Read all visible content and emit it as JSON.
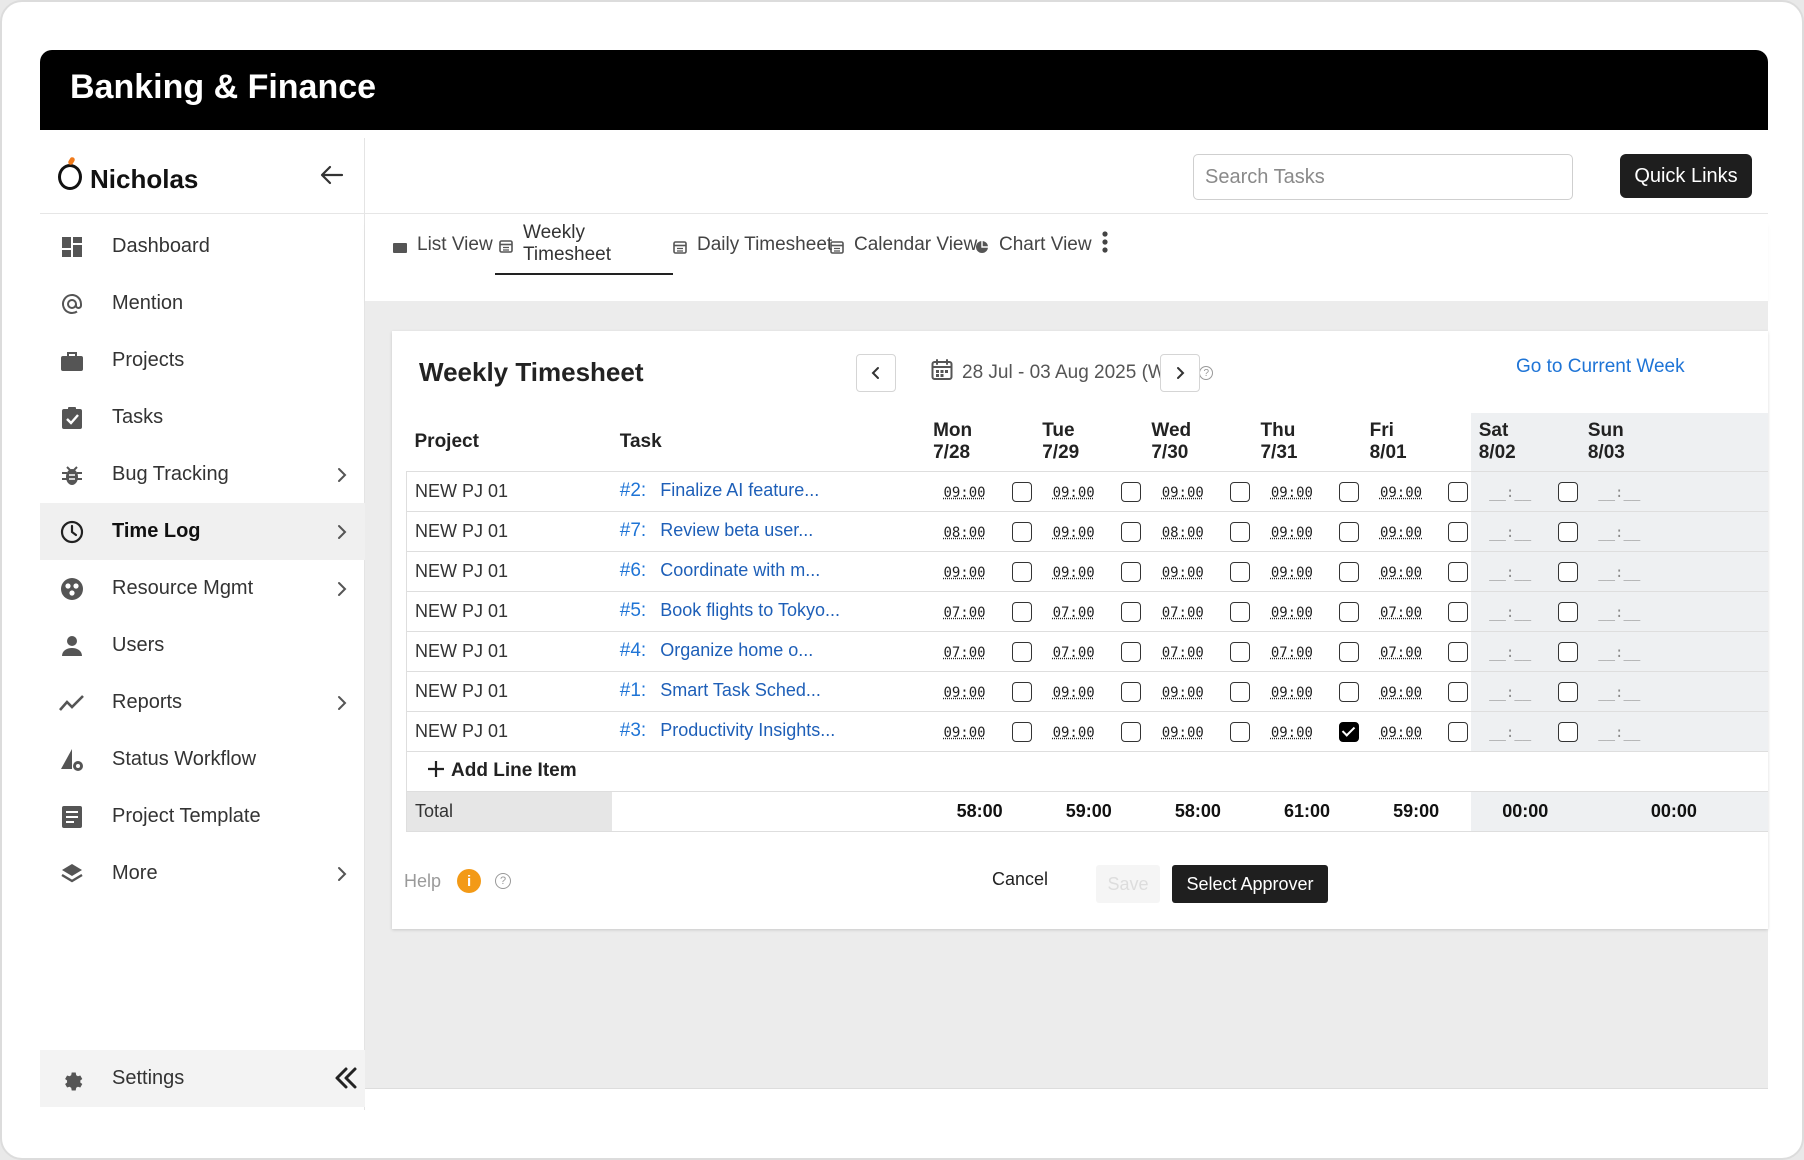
{
  "banner": {
    "title": "Banking & Finance"
  },
  "brand": {
    "name": "Nicholas"
  },
  "sidebar": {
    "items": [
      {
        "label": "Dashboard",
        "icon": "dashboard-icon",
        "chevron": false,
        "active": false
      },
      {
        "label": "Mention",
        "icon": "at-icon",
        "chevron": false,
        "active": false
      },
      {
        "label": "Projects",
        "icon": "briefcase-icon",
        "chevron": false,
        "active": false
      },
      {
        "label": "Tasks",
        "icon": "clipboard-check-icon",
        "chevron": false,
        "active": false
      },
      {
        "label": "Bug Tracking",
        "icon": "bug-icon",
        "chevron": true,
        "active": false
      },
      {
        "label": "Time Log",
        "icon": "clock-icon",
        "chevron": true,
        "active": true
      },
      {
        "label": "Resource Mgmt",
        "icon": "resource-icon",
        "chevron": true,
        "active": false
      },
      {
        "label": "Users",
        "icon": "user-icon",
        "chevron": false,
        "active": false
      },
      {
        "label": "Reports",
        "icon": "trend-icon",
        "chevron": true,
        "active": false
      },
      {
        "label": "Status Workflow",
        "icon": "workflow-icon",
        "chevron": false,
        "active": false
      },
      {
        "label": "Project Template",
        "icon": "template-icon",
        "chevron": false,
        "active": false
      },
      {
        "label": "More",
        "icon": "layers-icon",
        "chevron": true,
        "active": false
      }
    ],
    "settings_label": "Settings"
  },
  "topbar": {
    "search_placeholder": "Search Tasks",
    "quick_links": "Quick Links"
  },
  "tabs": [
    {
      "label": "List View",
      "icon": "list-icon",
      "active": false
    },
    {
      "label": "Weekly Timesheet",
      "icon": "calendar-icon",
      "active": true
    },
    {
      "label": "Daily Timesheet",
      "icon": "calendar-icon",
      "active": false
    },
    {
      "label": "Calendar View",
      "icon": "calendar-icon",
      "active": false
    },
    {
      "label": "Chart View",
      "icon": "pie-icon",
      "active": false
    }
  ],
  "timesheet": {
    "title": "Weekly Timesheet",
    "week_range": "28 Jul - 03 Aug 2025 (W31)",
    "goto_current": "Go to Current Week",
    "headers": {
      "project": "Project",
      "task": "Task"
    },
    "days": [
      {
        "day": "Mon",
        "date": "7/28",
        "weekend": false
      },
      {
        "day": "Tue",
        "date": "7/29",
        "weekend": false
      },
      {
        "day": "Wed",
        "date": "7/30",
        "weekend": false
      },
      {
        "day": "Thu",
        "date": "7/31",
        "weekend": false
      },
      {
        "day": "Fri",
        "date": "8/01",
        "weekend": false
      },
      {
        "day": "Sat",
        "date": "8/02",
        "weekend": true
      },
      {
        "day": "Sun",
        "date": "8/03",
        "weekend": true
      }
    ],
    "empty_time": "__:__",
    "rows": [
      {
        "project": "NEW PJ 01",
        "task_id": "#2:",
        "task_name": "Finalize AI feature...",
        "times": [
          "09:00",
          "09:00",
          "09:00",
          "09:00",
          "09:00"
        ],
        "checks": [
          false,
          false,
          false,
          false,
          false,
          false
        ]
      },
      {
        "project": "NEW PJ 01",
        "task_id": "#7:",
        "task_name": "Review beta user...",
        "times": [
          "08:00",
          "09:00",
          "08:00",
          "09:00",
          "09:00"
        ],
        "checks": [
          false,
          false,
          false,
          false,
          false,
          false
        ]
      },
      {
        "project": "NEW PJ 01",
        "task_id": "#6:",
        "task_name": "Coordinate with m...",
        "times": [
          "09:00",
          "09:00",
          "09:00",
          "09:00",
          "09:00"
        ],
        "checks": [
          false,
          false,
          false,
          false,
          false,
          false
        ]
      },
      {
        "project": "NEW PJ 01",
        "task_id": "#5:",
        "task_name": "Book flights to Tokyo...",
        "times": [
          "07:00",
          "07:00",
          "07:00",
          "09:00",
          "07:00"
        ],
        "checks": [
          false,
          false,
          false,
          false,
          false,
          false
        ]
      },
      {
        "project": "NEW PJ 01",
        "task_id": "#4:",
        "task_name": "Organize home o...",
        "times": [
          "07:00",
          "07:00",
          "07:00",
          "07:00",
          "07:00"
        ],
        "checks": [
          false,
          false,
          false,
          false,
          false,
          false
        ]
      },
      {
        "project": "NEW PJ 01",
        "task_id": "#1:",
        "task_name": "Smart Task Sched...",
        "times": [
          "09:00",
          "09:00",
          "09:00",
          "09:00",
          "09:00"
        ],
        "checks": [
          false,
          false,
          false,
          false,
          false,
          false
        ]
      },
      {
        "project": "NEW PJ 01",
        "task_id": "#3:",
        "task_name": "Productivity Insights...",
        "times": [
          "09:00",
          "09:00",
          "09:00",
          "09:00",
          "09:00"
        ],
        "checks": [
          false,
          false,
          false,
          true,
          false,
          false
        ]
      }
    ],
    "add_line": "Add Line Item",
    "total_label": "Total",
    "totals": [
      "58:00",
      "59:00",
      "58:00",
      "61:00",
      "59:00",
      "00:00",
      "00:00"
    ],
    "help_label": "Help",
    "cancel": "Cancel",
    "save": "Save",
    "select_approver": "Select Approver"
  },
  "colors": {
    "accent_blue": "#1e74d6",
    "active_nav_bg": "#f0f0f0",
    "help_orange": "#f39a16"
  }
}
